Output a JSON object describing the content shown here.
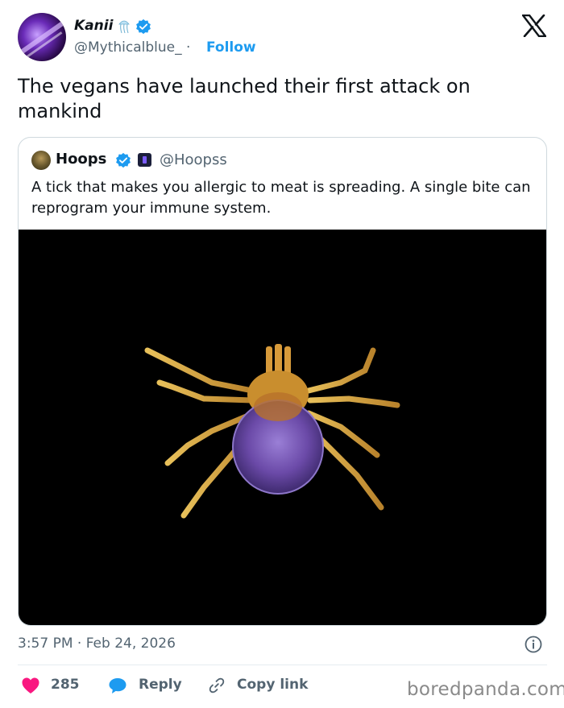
{
  "author": {
    "display_name": "Kanii",
    "handle": "@Mythicalblue_",
    "follow_separator": "·",
    "follow_label": "Follow",
    "name_emoji_icon": "jellyfish-icon",
    "verified_icon": "verified-badge-icon"
  },
  "platform_logo": "x-logo-icon",
  "tweet": {
    "text": "The vegans have launched their first attack on mankind"
  },
  "quoted_tweet": {
    "display_name": "Hoops",
    "handle": "@Hoopss",
    "verified_icon": "verified-badge-icon",
    "affiliate_icon": "affiliate-badge-icon",
    "text": "A tick that makes you allergic to meat is spreading. A single bite can reprogram your immune system.",
    "image": "tick-photo"
  },
  "meta": {
    "timestamp": "3:57 PM · Feb 24, 2026",
    "info_icon": "info-icon"
  },
  "actions": {
    "like_count": "285",
    "reply_label": "Reply",
    "copy_link_label": "Copy link"
  },
  "watermark": "boredpanda.com",
  "colors": {
    "accent": "#1d9bf0",
    "like": "#f91880",
    "text": "#0f1419",
    "muted": "#536471"
  }
}
